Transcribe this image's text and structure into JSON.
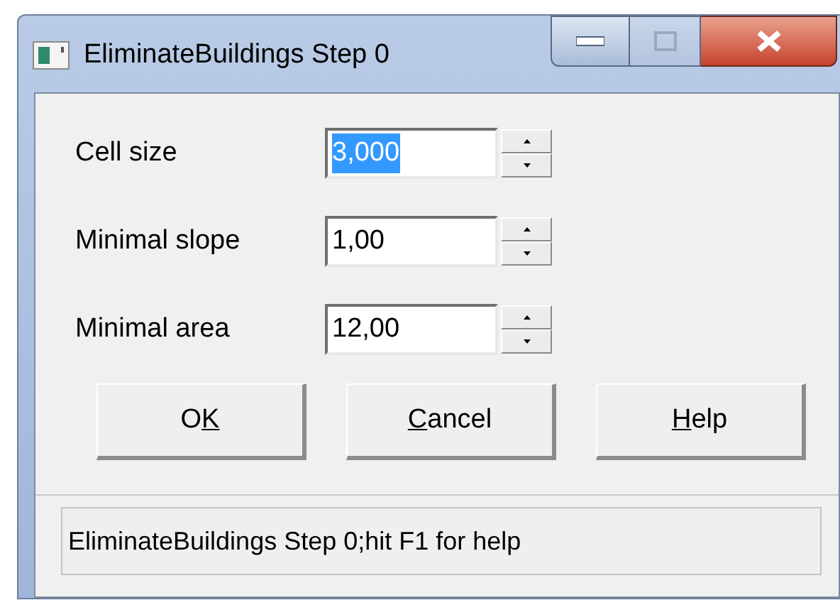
{
  "window": {
    "title": "EliminateBuildings Step 0",
    "maximize_disabled": true
  },
  "fields": [
    {
      "label": "Cell size",
      "value": "3,000",
      "selected": true
    },
    {
      "label": "Minimal slope",
      "value": "1,00",
      "selected": false
    },
    {
      "label": "Minimal area",
      "value": "12,00",
      "selected": false
    }
  ],
  "buttons": [
    {
      "parts": [
        {
          "text": "O",
          "underlined": false
        },
        {
          "text": "K",
          "underlined": true
        }
      ]
    },
    {
      "parts": [
        {
          "text": "C",
          "underlined": true
        },
        {
          "text": "ancel",
          "underlined": false
        }
      ]
    },
    {
      "parts": [
        {
          "text": "H",
          "underlined": true
        },
        {
          "text": "elp",
          "underlined": false
        }
      ]
    }
  ],
  "status_bar": "EliminateBuildings Step 0;hit F1 for help"
}
